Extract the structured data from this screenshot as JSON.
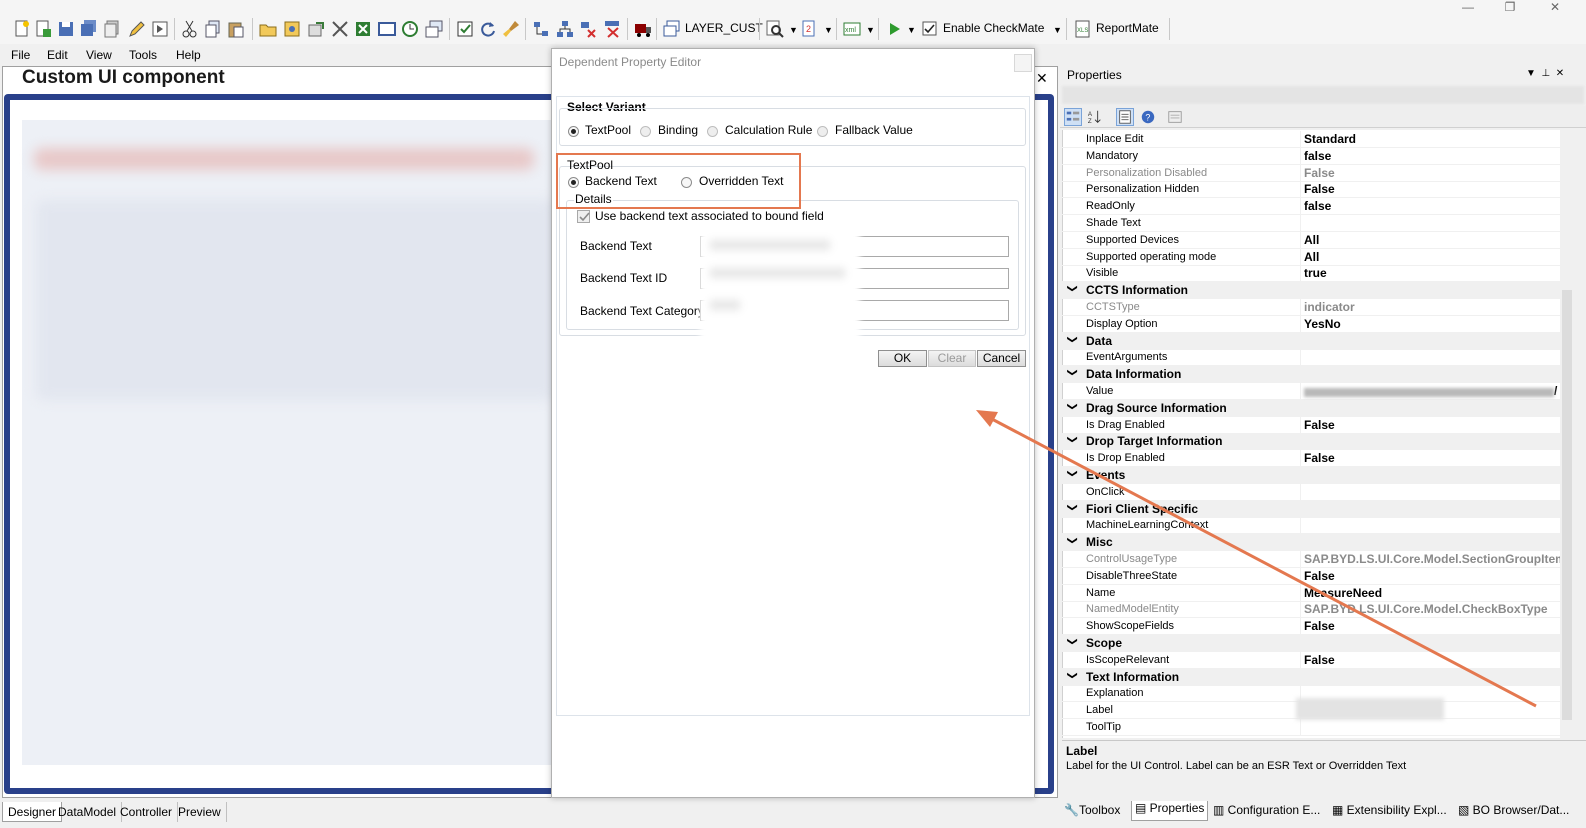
{
  "toolbar": {
    "layer_label": "LAYER_CUST",
    "checkmate_label": "Enable CheckMate",
    "reportmate_label": "ReportMate"
  },
  "menu": [
    "File",
    "Edit",
    "View",
    "Tools",
    "Help"
  ],
  "designer": {
    "title": "Custom UI component",
    "tabs": [
      "Designer",
      "DataModel",
      "Controller",
      "Preview"
    ]
  },
  "dialog": {
    "title": "Dependent Property Editor",
    "select_variant_label": "Select Variant",
    "variants": [
      "TextPool",
      "Binding",
      "Calculation Rule",
      "Fallback Value"
    ],
    "textpool_label": "TextPool",
    "textpool_options": [
      "Backend Text",
      "Overridden Text"
    ],
    "details_label": "Details",
    "use_backend_label": "Use backend text associated to bound field",
    "fields": [
      "Backend Text",
      "Backend Text ID",
      "Backend Text Category"
    ],
    "buttons": {
      "ok": "OK",
      "clear": "Clear",
      "cancel": "Cancel"
    }
  },
  "properties": {
    "title": "Properties",
    "rows": [
      {
        "name": "Inplace Edit",
        "value": "Standard"
      },
      {
        "name": "Mandatory",
        "value": "false"
      },
      {
        "name": "Personalization Disabled",
        "value": "False"
      },
      {
        "name": "Personalization Hidden",
        "value": "False"
      },
      {
        "name": "ReadOnly",
        "value": "false"
      },
      {
        "name": "Shade Text",
        "value": ""
      },
      {
        "name": "Supported Devices",
        "value": "All"
      },
      {
        "name": "Supported operating mode",
        "value": "All"
      },
      {
        "name": "Visible",
        "value": "true"
      },
      {
        "category": "CCTS Information"
      },
      {
        "name": "CCTSType",
        "value": "indicator"
      },
      {
        "name": "Display Option",
        "value": "YesNo"
      },
      {
        "category": "Data"
      },
      {
        "name": "EventArguments",
        "value": ""
      },
      {
        "category": "Data Information"
      },
      {
        "name": "Value",
        "value": "/"
      },
      {
        "category": "Drag Source Information"
      },
      {
        "name": "Is Drag Enabled",
        "value": "False"
      },
      {
        "category": "Drop Target Information"
      },
      {
        "name": "Is Drop Enabled",
        "value": "False"
      },
      {
        "category": "Events"
      },
      {
        "name": "OnClick",
        "value": ""
      },
      {
        "category": "Fiori Client Specific"
      },
      {
        "name": "MachineLearningContext",
        "value": ""
      },
      {
        "category": "Misc"
      },
      {
        "name": "ControlUsageType",
        "value": "SAP.BYD.LS.UI.Core.Model.SectionGroupItemT"
      },
      {
        "name": "DisableThreeState",
        "value": "False"
      },
      {
        "name": "Name",
        "value": "MeasureNeed"
      },
      {
        "name": "NamedModelEntity",
        "value": "SAP.BYD.LS.UI.Core.Model.CheckBoxType"
      },
      {
        "name": "ShowScopeFields",
        "value": "False"
      },
      {
        "category": "Scope"
      },
      {
        "name": "IsScopeRelevant",
        "value": "False"
      },
      {
        "category": "Text Information"
      },
      {
        "name": "Explanation",
        "value": ""
      },
      {
        "name": "Label",
        "value": ""
      },
      {
        "name": "ToolTip",
        "value": ""
      }
    ],
    "description_title": "Label",
    "description_text": "Label for the UI Control. Label can be an ESR Text or Overridden Text",
    "tabs": [
      "Toolbox",
      "Properties",
      "Configuration E...",
      "Extensibility Expl...",
      "BO Browser/Dat..."
    ]
  },
  "colors": {
    "highlight": "#e4784f",
    "designer_frame": "#29408a"
  }
}
